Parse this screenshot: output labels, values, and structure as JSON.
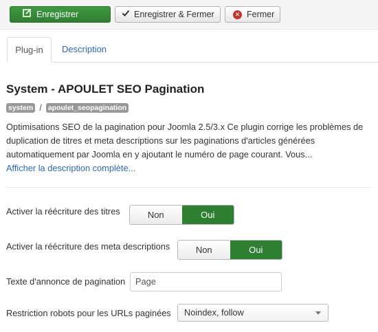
{
  "toolbar": {
    "save_label": "Enregistrer",
    "save_close_label": "Enregistrer & Fermer",
    "close_label": "Fermer",
    "save_color": "#2f7d32",
    "close_icon_color": "#bd362f"
  },
  "tabs": [
    {
      "label": "Plug-in",
      "active": true
    },
    {
      "label": "Description",
      "active": false
    }
  ],
  "plugin": {
    "title": "System - APOULET SEO Pagination",
    "folder_label": "system",
    "separator": "/",
    "element_label": "apoulet_seopagination",
    "description": "Optimisations SEO de la pagination pour Joomla 2.5/3.x Ce plugin corrige les problèmes de duplication de titres et meta descriptions sur les paginations d'articles générées automatiquement par Joomla en y ajoutant le numéro de page courant. Vous...",
    "show_more": "Afficher la description complète..."
  },
  "fields": {
    "titles_rewrite": {
      "label": "Activer la réécriture des titres",
      "no": "Non",
      "yes": "Oui",
      "selected": "Oui"
    },
    "meta_rewrite": {
      "label": "Activer la réécriture des meta descriptions",
      "no": "Non",
      "yes": "Oui",
      "selected": "Oui"
    },
    "page_text": {
      "label": "Texte d'annonce de pagination",
      "value": "Page"
    },
    "robots": {
      "label": "Restriction robots pour les URLs paginées",
      "value": "Noindex, follow"
    }
  },
  "colors": {
    "toggle_on": "#2f7f32",
    "link": "#2a69b8"
  }
}
